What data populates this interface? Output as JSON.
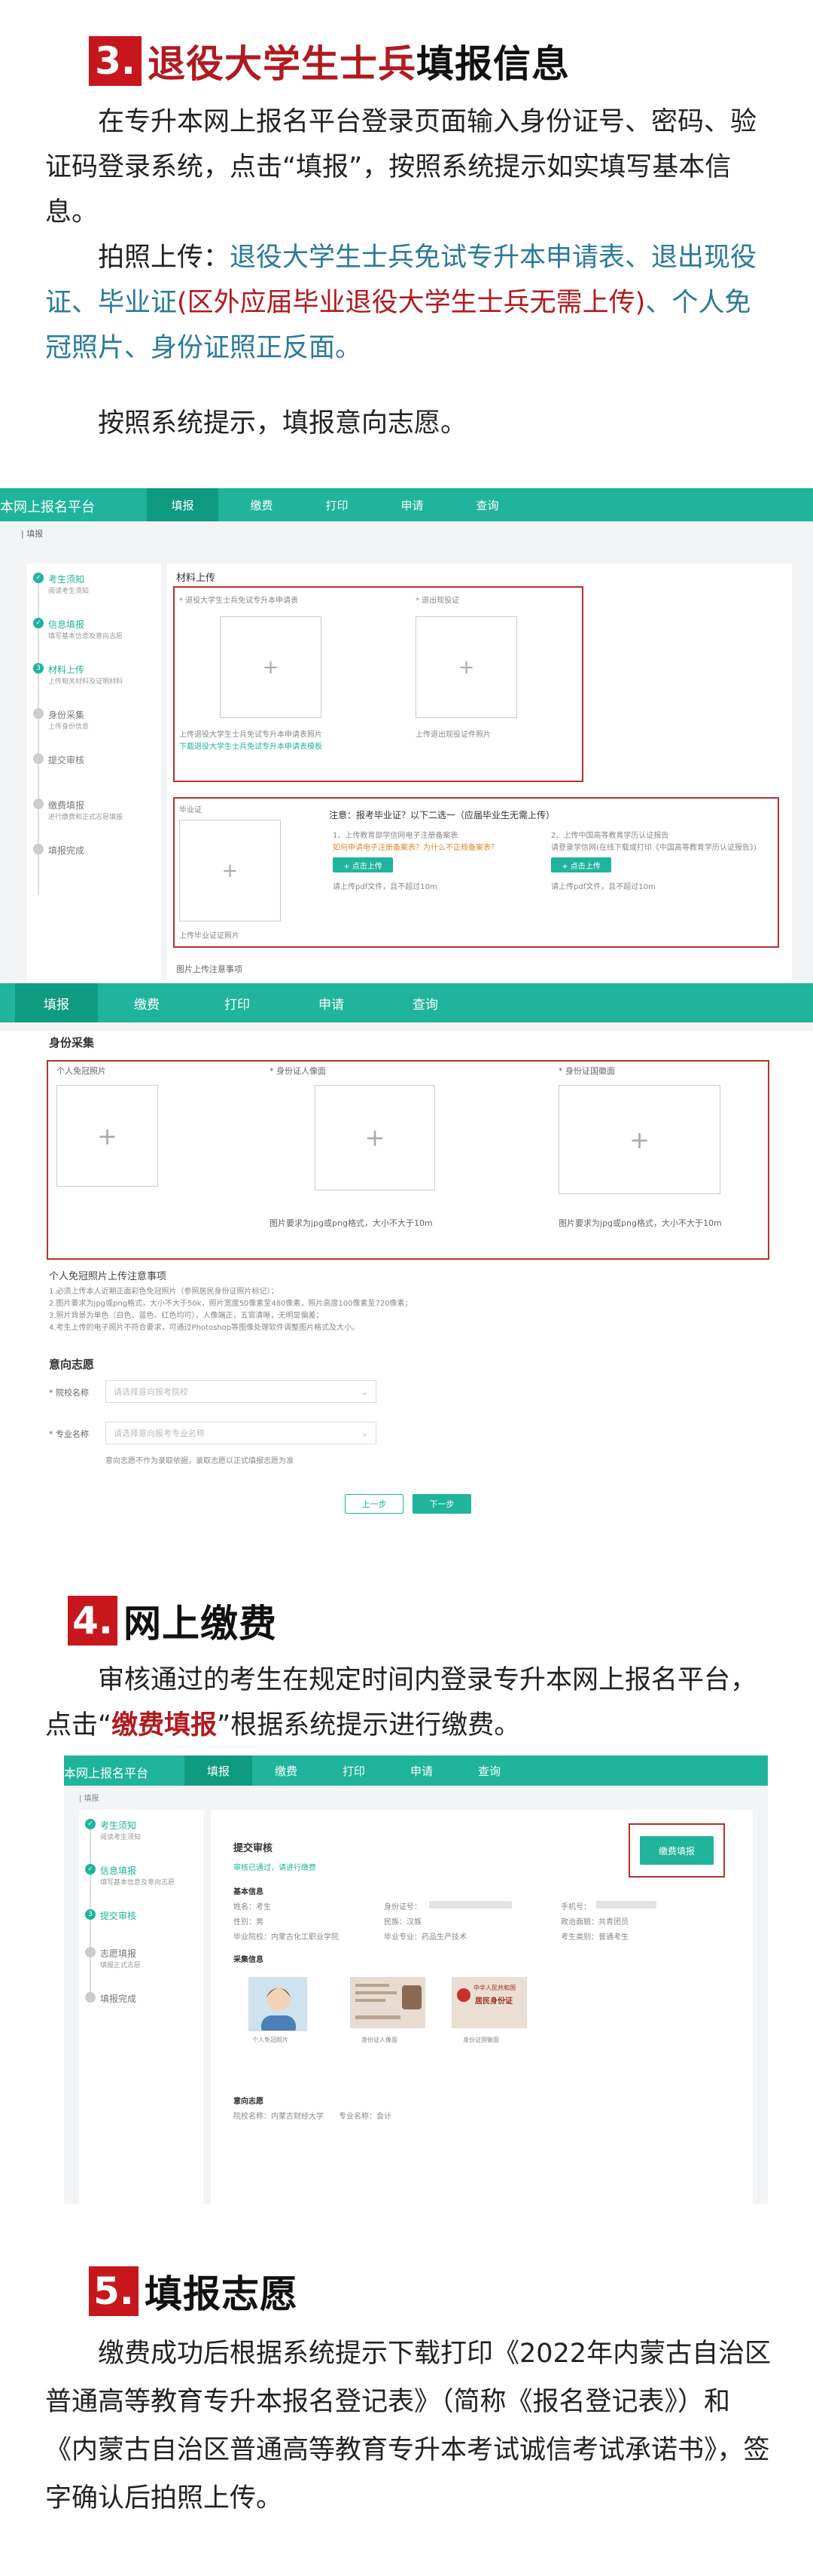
{
  "s3": {
    "num": "3.",
    "title_red": "退役大学生士兵",
    "title_black": "填报信息",
    "p1": "在专升本网上报名平台登录页面输入身份证号、密码、验证码登录系统，点击“填报”，按照系统提示如实填写基本信息。",
    "p2_a": "拍照上传：",
    "p2_b": "退役大学生士兵免试专升本申请表、退出现役证、毕业证",
    "p2_c": "(区外应届毕业退役大学生士兵无需上传)",
    "p2_d": "、个人免冠照片、身份证照正反面。",
    "p3": "按照系统提示，填报意向志愿。"
  },
  "shot1": {
    "brand": "本网上报名平台",
    "nav": [
      "填报",
      "缴费",
      "打印",
      "申请",
      "查询"
    ],
    "crumb": "| 填报",
    "steps": [
      {
        "t": "考生须知",
        "s": "阅读考生须知"
      },
      {
        "t": "信息填报",
        "s": "填写基本信息及意向志愿"
      },
      {
        "t": "材料上传",
        "s": "上传相关材料及证明材料"
      },
      {
        "t": "身份采集",
        "s": "上传身份信息"
      },
      {
        "t": "提交审核",
        "s": ""
      },
      {
        "t": "缴费填报",
        "s": "进行缴费和正式志愿填报"
      },
      {
        "t": "填报完成",
        "s": ""
      }
    ],
    "section": "材料上传",
    "label_a": "* 退役大学生士兵免试专升本申请表",
    "label_b": "* 退出现役证",
    "hint_a": "上传退役大学生士兵免试专升本申请表照片",
    "link_a": "下载退役大学生士兵免试专升本申请表模板",
    "hint_b": "上传退出现役证件照片",
    "label_c": "毕业证",
    "hint_c": "上传毕业证证照片",
    "notice": "注意：报考毕业证？以下二选一（应届毕业生无需上传）",
    "opt1": "1、上传教育部学信网电子注册备案表",
    "opt1_link": "如何申请电子注册备案表？为什么不正规备案表？",
    "opt2": "2、上传中国高等教育学历认证报告",
    "opt2_hint": "请登录学信网(在线下载或打印《中国高等教育学历认证报告》)",
    "btn": "+ 点击上传",
    "note": "请上传pdf文件，且不超过10m",
    "bottom": "图片上传注意事项"
  },
  "shot2": {
    "nav": [
      "填报",
      "缴费",
      "打印",
      "申请",
      "查询"
    ],
    "section": "身份采集",
    "label_a": "个人免冠照片",
    "label_b": "* 身份证人像面",
    "label_c": "* 身份证国徽面",
    "req": "图片要求为jpg或png格式，大小不大于10m",
    "notes_title": "个人免冠照片上传注意事项",
    "notes": [
      "1.必须上传本人近期正面彩色免冠照片（参照居民身份证照片标记）；",
      "2.图片要求为jpg或png格式，大小不大于50k，照片宽度50像素至480像素，照片高度100像素至720像素；",
      "3.照片背景为单色（白色、蓝色、红色均可），人像端正，五官清晰，无明显偏差；",
      "4.考生上传的电子照片不符合要求，可通过Photoshop等图像处理软件调整图片格式及大小。"
    ],
    "pref": "意向志愿",
    "f1": "* 院校名称",
    "f1_ph": "请选择意向报考院校",
    "f2": "* 专业名称",
    "f2_ph": "请选择意向报考专业名称",
    "pref_note": "意向志愿不作为录取依据，录取志愿以正式填报志愿为准",
    "prev": "上一步",
    "next": "下一步"
  },
  "s4": {
    "num": "4.",
    "title": "网上缴费",
    "p1_a": "审核通过的考生在规定时间内登录专升本网上报名平台，点击“",
    "p1_b": "缴费填报",
    "p1_c": "”根据系统提示进行缴费。"
  },
  "shot3": {
    "brand": "本网上报名平台",
    "nav": [
      "填报",
      "缴费",
      "打印",
      "申请",
      "查询"
    ],
    "crumb": "| 填报",
    "steps": [
      {
        "t": "考生须知",
        "s": "阅读考生须知"
      },
      {
        "t": "信息填报",
        "s": "填写基本信息及意向志愿"
      },
      {
        "t": "提交审核",
        "s": ""
      },
      {
        "t": "志愿填报",
        "s": "填报正式志愿"
      },
      {
        "t": "填报完成",
        "s": ""
      }
    ],
    "title": "提交审核",
    "status": "审核已通过，请进行缴费",
    "pay_btn": "缴费填报",
    "basic": "基本信息",
    "r1": [
      "姓名：考生",
      "身份证号：",
      "手机号："
    ],
    "r2": [
      "性别：男",
      "民族：汉族",
      "政治面貌：共青团员"
    ],
    "r3": [
      "毕业院校：内蒙古化工职业学院",
      "毕业专业：药品生产技术",
      "考生类别：普通考生"
    ],
    "collect": "采集信息",
    "ph1": "个人免冠照片",
    "ph2": "身份证人像面",
    "ph3": "身份证国徽面",
    "id_title": "中华人民共和国",
    "id_sub": "居民身份证",
    "pref": "意向志愿",
    "pref_line": "院校名称：内蒙古财经大学　　专业名称：会计"
  },
  "s5": {
    "num": "5.",
    "title": "填报志愿",
    "p1": "缴费成功后根据系统提示下载打印《2022年内蒙古自治区普通高等教育专升本报名登记表》（简称《报名登记表》）和《内蒙古自治区普通高等教育专升本考试诚信考试承诺书》，签字确认后拍照上传。"
  },
  "colors": {
    "accent": "#1fb49b",
    "red": "#c8161d",
    "blue": "#2b7a9a"
  }
}
